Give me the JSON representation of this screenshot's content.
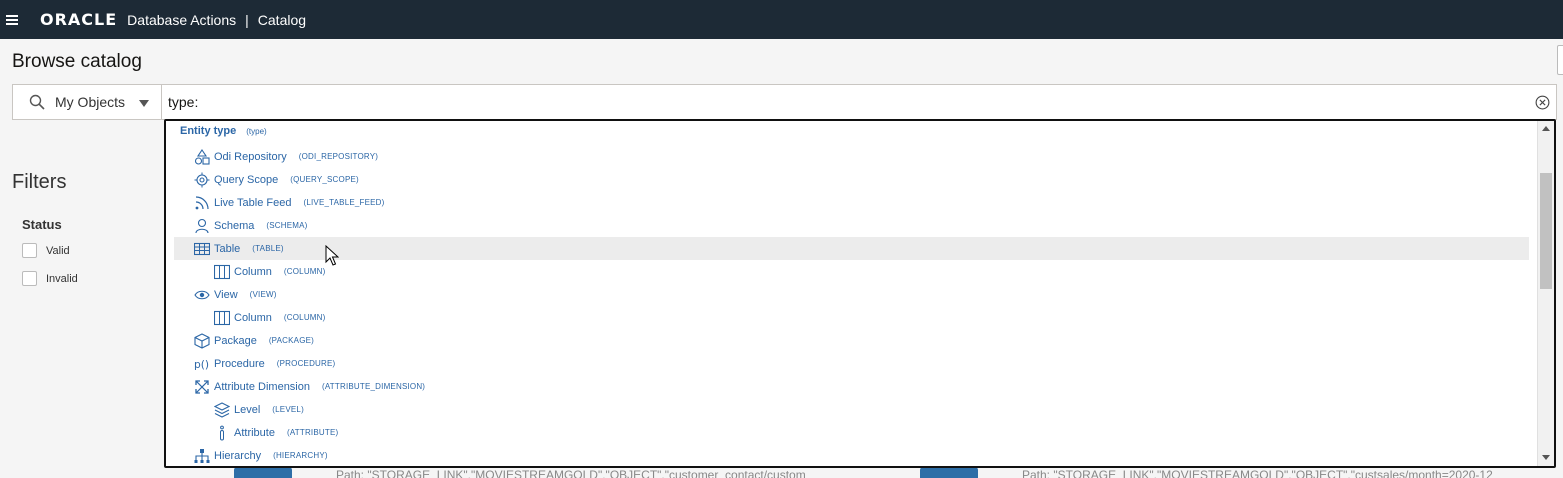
{
  "header": {
    "brand": "ORACLE",
    "app_title": "Database Actions",
    "separator": "|",
    "page": "Catalog",
    "colors": {
      "background": "#1d2a36",
      "text": "#ffffff"
    }
  },
  "main": {
    "title": "Browse catalog"
  },
  "search": {
    "scope_label": "My Objects",
    "query": "type:",
    "icons": {
      "scope": "search-icon",
      "clear": "clear-circle-icon"
    }
  },
  "filters": {
    "title": "Filters",
    "status_label": "Status",
    "options": [
      {
        "label": "Valid",
        "checked": false
      },
      {
        "label": "Invalid",
        "checked": false
      }
    ]
  },
  "dropdown": {
    "header": {
      "label": "Entity type",
      "key": "(type)"
    },
    "items": [
      {
        "label": "Odi Repository",
        "key": "(ODI_REPOSITORY)",
        "icon": "shapes-icon",
        "indent": 0
      },
      {
        "label": "Query Scope",
        "key": "(QUERY_SCOPE)",
        "icon": "target-icon",
        "indent": 0
      },
      {
        "label": "Live Table Feed",
        "key": "(LIVE_TABLE_FEED)",
        "icon": "feed-icon",
        "indent": 0
      },
      {
        "label": "Schema",
        "key": "(SCHEMA)",
        "icon": "user-icon",
        "indent": 0
      },
      {
        "label": "Table",
        "key": "(TABLE)",
        "icon": "table-icon",
        "indent": 0,
        "highlighted": true
      },
      {
        "label": "Column",
        "key": "(COLUMN)",
        "icon": "column-icon",
        "indent": 1
      },
      {
        "label": "View",
        "key": "(VIEW)",
        "icon": "eye-icon",
        "indent": 0
      },
      {
        "label": "Column",
        "key": "(COLUMN)",
        "icon": "column-icon",
        "indent": 1
      },
      {
        "label": "Package",
        "key": "(PACKAGE)",
        "icon": "package-icon",
        "indent": 0
      },
      {
        "label": "Procedure",
        "key": "(PROCEDURE)",
        "icon": "procedure-icon",
        "indent": 0
      },
      {
        "label": "Attribute Dimension",
        "key": "(ATTRIBUTE_DIMENSION)",
        "icon": "expand-icon",
        "indent": 0
      },
      {
        "label": "Level",
        "key": "(LEVEL)",
        "icon": "layers-icon",
        "indent": 1
      },
      {
        "label": "Attribute",
        "key": "(ATTRIBUTE)",
        "icon": "info-icon",
        "indent": 1
      },
      {
        "label": "Hierarchy",
        "key": "(HIERARCHY)",
        "icon": "hierarchy-icon",
        "indent": 0
      }
    ],
    "accent_color": "#2b66a6"
  },
  "background_cards": [
    {
      "path": "Path: \"STORAGE_LINK\".\"MOVIESTREAMGOLD\".\"OBJECT\".\"customer_contact/custom"
    },
    {
      "path": "Path: \"STORAGE_LINK\".\"MOVIESTREAMGOLD\".\"OBJECT\".\"custsales/month=2020-12"
    }
  ]
}
